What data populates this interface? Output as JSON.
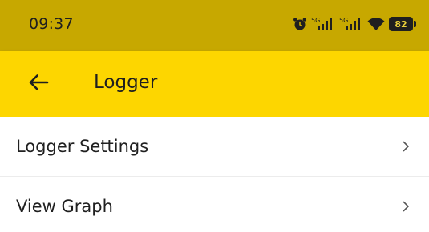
{
  "status_bar": {
    "time": "09:37",
    "battery_level": "82",
    "background_color": "#c7a800",
    "icons": [
      "alarm-icon",
      "signal-5g-icon",
      "signal-5g-icon",
      "wifi-icon",
      "battery-icon"
    ],
    "signal_label_1": "5G",
    "signal_label_2": "5G"
  },
  "app_bar": {
    "title": "Logger",
    "back_icon": "arrow-left-icon",
    "background_color": "#fdd600"
  },
  "menu": {
    "items": [
      {
        "label": "Logger Settings",
        "icon": "chevron-right-icon"
      },
      {
        "label": "View Graph",
        "icon": "chevron-right-icon"
      }
    ]
  }
}
